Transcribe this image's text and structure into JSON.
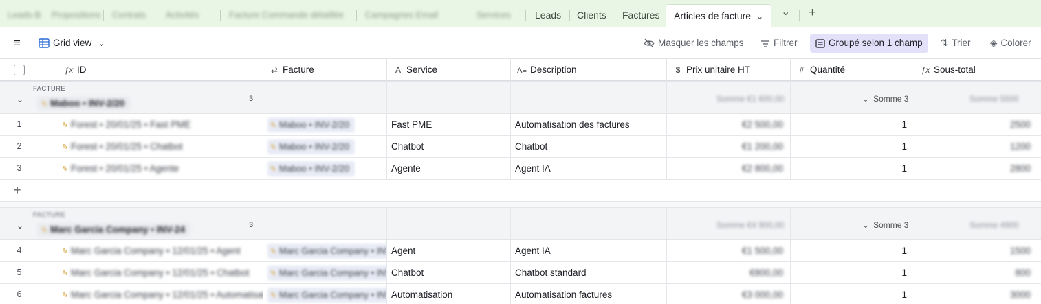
{
  "tabs": {
    "blurred": [
      "Leads-B",
      "Propositions",
      "Contrats",
      "Activités",
      "Facture Commande détaillée",
      "Campagnes Email",
      "Services"
    ],
    "leads": "Leads",
    "clients": "Clients",
    "factures": "Factures",
    "active": "Articles de facture",
    "more_icon": "chevron-down-icon",
    "add_icon": "plus-icon"
  },
  "toolbar": {
    "view_name": "Grid view",
    "hide_fields": "Masquer les champs",
    "filter": "Filtrer",
    "grouped": "Groupé selon 1 champ",
    "sort": "Trier",
    "color": "Colorer"
  },
  "columns": {
    "id": "ID",
    "facture": "Facture",
    "service": "Service",
    "description": "Description",
    "prix": "Prix unitaire HT",
    "quantite": "Quantité",
    "sous_total": "Sous-total"
  },
  "groups": [
    {
      "label": "FACTURE",
      "value": "Maboo • INV-2/20",
      "count": "3",
      "sum_label": "Somme 3",
      "blur_prix": "Somme €1 600,00",
      "blur_sous": "Somme 5500",
      "rows": [
        {
          "num": "1",
          "id": "Forest • 20/01/25 • Fast PME",
          "facture": "Maboo • INV-2/20",
          "service": "Fast PME",
          "description": "Automatisation des factures",
          "prix": "€2 500,00",
          "quantite": "1",
          "sous_total": "2500"
        },
        {
          "num": "2",
          "id": "Forest • 20/01/25 • Chatbot",
          "facture": "Maboo • INV-2/20",
          "service": "Chatbot",
          "description": "Chatbot",
          "prix": "€1 200,00",
          "quantite": "1",
          "sous_total": "1200"
        },
        {
          "num": "3",
          "id": "Forest • 20/01/25 • Agente",
          "facture": "Maboo • INV-2/20",
          "service": "Agente",
          "description": "Agent IA",
          "prix": "€2 800,00",
          "quantite": "1",
          "sous_total": "2800"
        }
      ]
    },
    {
      "label": "FACTURE",
      "value": "Marc Garcia Company • INV-24",
      "count": "3",
      "sum_label": "Somme 3",
      "blur_prix": "Somme €4 900,00",
      "blur_sous": "Somme 4900",
      "rows": [
        {
          "num": "4",
          "id": "Marc Garcia Company • 12/01/25 • Agent",
          "facture": "Marc Garcia Company • INV",
          "service": "Agent",
          "description": "Agent IA",
          "prix": "€1 500,00",
          "quantite": "1",
          "sous_total": "1500"
        },
        {
          "num": "5",
          "id": "Marc Garcia Company • 12/01/25 • Chatbot",
          "facture": "Marc Garcia Company • INV",
          "service": "Chatbot",
          "description": "Chatbot standard",
          "prix": "€800,00",
          "quantite": "1",
          "sous_total": "800"
        },
        {
          "num": "6",
          "id": "Marc Garcia Company • 12/01/25 • Automatisation",
          "facture": "Marc Garcia Company • INV",
          "service": "Automatisation",
          "description": "Automatisation factures",
          "prix": "€3 000,00",
          "quantite": "1",
          "sous_total": "3000"
        }
      ]
    }
  ]
}
